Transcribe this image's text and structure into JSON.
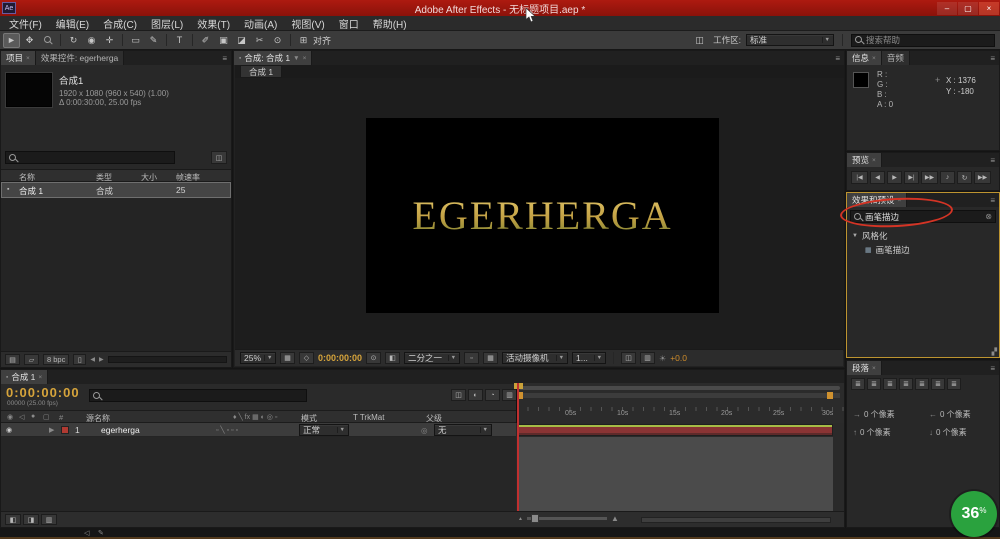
{
  "titlebar": {
    "app_initials": "Ae",
    "title": "Adobe After Effects - 无标题项目.aep *"
  },
  "menubar": {
    "items": [
      "文件(F)",
      "编辑(E)",
      "合成(C)",
      "图层(L)",
      "效果(T)",
      "动画(A)",
      "视图(V)",
      "窗口",
      "帮助(H)"
    ]
  },
  "toolbar": {
    "align_label": "对齐",
    "workspace_label": "工作区:",
    "workspace_value": "标准",
    "search_placeholder": "搜索帮助"
  },
  "project": {
    "tab_project": "项目",
    "tab_effect_controls": "效果控件: egerherga",
    "comp_name": "合成1",
    "comp_info_1": "1920 x 1080  (960 x 540) (1.00)",
    "comp_info_2": "Δ 0:00:30:00, 25.00 fps",
    "columns": {
      "name": "名称",
      "type": "类型",
      "size": "大小",
      "fps": "帧速率"
    },
    "row": {
      "name": "合成 1",
      "type": "合成",
      "fps": "25"
    },
    "bit_depth": "8 bpc"
  },
  "comp": {
    "tab_label": "合成: 合成 1",
    "viewer_tab": "合成 1",
    "canvas_text": "EGERHERGA",
    "zoom": "25%",
    "timecode": "0:00:00:00",
    "resolution": "二分之一",
    "camera": "活动摄像机",
    "view_layout": "1...",
    "exposure": "+0.0"
  },
  "info": {
    "tab_info": "信息",
    "tab_audio": "音频",
    "r": "R :",
    "g": "G :",
    "b": "B :",
    "a": "A : 0",
    "x": "X : 1376",
    "y": "Y : -180"
  },
  "preview": {
    "tab": "预览"
  },
  "effects": {
    "tab": "效果和预设",
    "search_value": "画笔描边",
    "category": "风格化",
    "effect_name": "画笔描边"
  },
  "paragraph": {
    "tab": "段落",
    "indent_left": "0 个像素",
    "indent_right": "0 个像素",
    "space_before": "0 个像素",
    "space_after": "0 个像素"
  },
  "timeline": {
    "tab": "合成 1",
    "timecode": "0:00:00:00",
    "timecode_sub": "00000 (25.00 fps)",
    "columns": {
      "source_name": "源名称",
      "mode": "模式",
      "trkmat": "T TrkMat",
      "parent": "父级"
    },
    "layer": {
      "index": "1",
      "name": "egerherga",
      "mode": "正常",
      "parent": "无"
    },
    "ticks": [
      "05s",
      "10s",
      "15s",
      "20s",
      "25s",
      "30s"
    ]
  },
  "watermark": {
    "value": "36",
    "unit": "%"
  },
  "colors": {
    "titlebar_red": "#a01812",
    "accent_gold": "#d6a43b",
    "annotation_red": "#d43425",
    "watermark_green": "#2aa23e",
    "layer_bar_red": "#8a3434",
    "layer_bar_green": "#a6bc46",
    "focus_border_orange": "#bd9430"
  },
  "icons": {
    "minimize": "–",
    "maximize": "▢",
    "close": "×",
    "panel_menu": "≡",
    "dropdown_arrow": "▼",
    "tree_open": "▼",
    "expander": "▶",
    "tab_icon": "▪",
    "selection_tool": "►",
    "hand_tool": "✥",
    "rotate_tool": "↻",
    "camera_tool": "◉",
    "pan_behind_tool": "✛",
    "shape_tool": "▭",
    "pen_tool": "✎",
    "text_tool": "T",
    "brush_tool": "✐",
    "clone_tool": "▣",
    "eraser_tool": "◪",
    "roto_tool": "✂",
    "puppet_tool": "⊙",
    "align_check": "⊞",
    "workspace_icon": "◫",
    "folder": "▤",
    "new_folder": "▱",
    "trash": "▯",
    "scroll_left": "◀",
    "scroll_right": "▶",
    "grid": "▦",
    "mask_vis": "◇",
    "snapshot": "⊙",
    "channels": "◧",
    "region": "▫",
    "flowchart": "◫",
    "graph_editor": "▥",
    "motion_blur": "◐",
    "frame_blend": "◔",
    "exposure": "☀",
    "crosshair": "+",
    "first_frame": "|◀",
    "prev_frame": "◀",
    "play": "▶",
    "next_frame": "▶|",
    "last_frame": "▶▶",
    "speaker": "♪",
    "loop": "↻",
    "ram_preview": "▶▶",
    "effect": "▦",
    "clear_search": "⊗",
    "resize_grip": "▞",
    "justify": "≣",
    "indent_left_icon": "→",
    "indent_right_icon": "←",
    "space_before_icon": "↑",
    "space_after_icon": "↓",
    "eye": "◉",
    "speaker_col": "◁",
    "solo": "●",
    "lock": "▢",
    "hash": "#",
    "pickwhip": "◎",
    "switches_header": "♦ ╲ fx ▦ ◐ ◎ ▫",
    "layer_switches": "▫ ╲ ▫ ▫ ▫",
    "mountain": "▲",
    "toggle_a": "◧",
    "toggle_b": "◨",
    "toggle_c": "▥",
    "pencil": "✎"
  }
}
